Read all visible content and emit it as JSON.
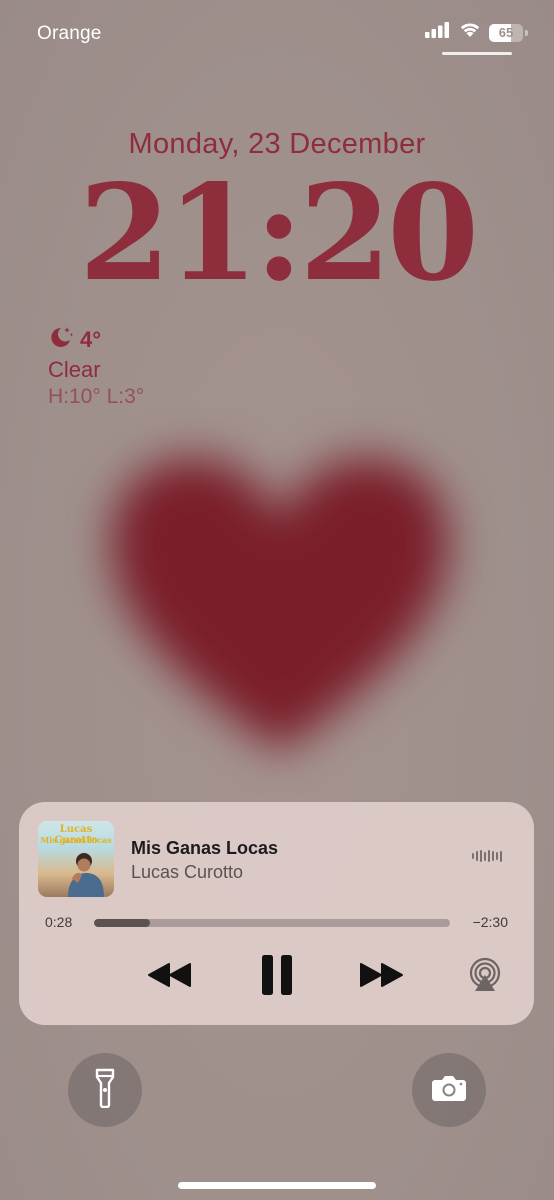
{
  "status_bar": {
    "carrier": "Orange",
    "battery_percent": 65,
    "battery_label": "65",
    "signal_icon": "cellular-signal-icon",
    "wifi_icon": "wifi-icon"
  },
  "lock_screen": {
    "date": "Monday, 23 December",
    "time": "21:20"
  },
  "weather": {
    "icon": "moon-stars-icon",
    "temperature": "4°",
    "condition": "Clear",
    "high_low": "H:10° L:3°"
  },
  "now_playing": {
    "title": "Mis Ganas Locas",
    "artist": "Lucas Curotto",
    "artwork_artist_text": "Lucas Curotto",
    "artwork_album_text": "Mis ganas locas",
    "elapsed": "0:28",
    "remaining": "−2:30",
    "progress_fraction": 0.157,
    "controls": {
      "rewind_icon": "rewind-icon",
      "pause_icon": "pause-icon",
      "forward_icon": "fast-forward-icon",
      "airplay_icon": "airplay-audio-icon"
    }
  },
  "quick_actions": {
    "left_icon": "flashlight-icon",
    "right_icon": "camera-icon"
  },
  "colors": {
    "accent": "#8e2d3c",
    "wallpaper": "#a1928f",
    "heart": "#7a1e2a"
  }
}
